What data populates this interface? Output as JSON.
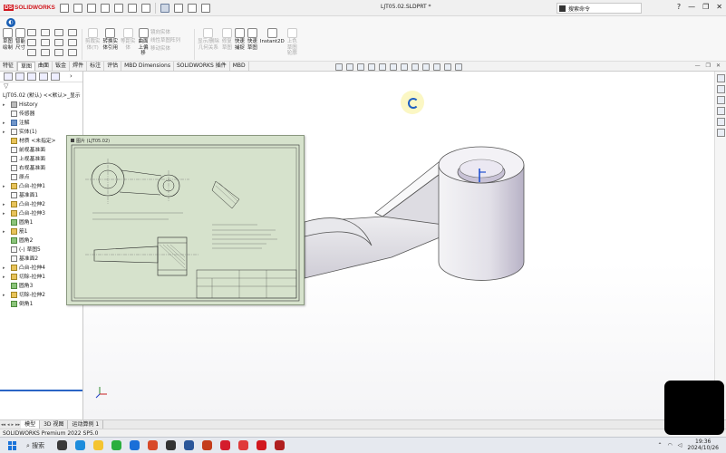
{
  "app": {
    "logo": "SOLIDWORKS",
    "document_title": "LJT05.02.SLDPRT *",
    "search_placeholder": "搜索命令"
  },
  "window_controls": {
    "help": "?",
    "minimize": "—",
    "restore": "❐",
    "close": "✕"
  },
  "ribbon": {
    "command_manager_icon": "expand-icon",
    "sketch_group": [
      {
        "label": "草图\n绘制"
      },
      {
        "label": "智能\n尺寸"
      }
    ],
    "entity_group": [
      {
        "label": "剪裁实\n体(T)",
        "enabled": false
      },
      {
        "label": "转换实\n体引用",
        "enabled": true
      },
      {
        "label": "等距实\n体",
        "enabled": false
      },
      {
        "label": "曲面\n上偏\n移",
        "enabled": true
      }
    ],
    "mirror_list": [
      "镜向实体",
      "线性草图阵列",
      "移动实体"
    ],
    "display_group": [
      {
        "label": "显示/删除\n几何关系",
        "enabled": false
      },
      {
        "label": "修复\n草图",
        "enabled": false
      },
      {
        "label": "快速\n捕捉",
        "enabled": true
      },
      {
        "label": "快速\n草图",
        "enabled": true
      },
      {
        "label": "Instant2D",
        "enabled": true
      },
      {
        "label": "上色\n草图\n轮廓",
        "enabled": false
      }
    ]
  },
  "tabs": [
    "特征",
    "草图",
    "曲面",
    "钣金",
    "焊件",
    "标注",
    "评估",
    "MBD Dimensions",
    "SOLIDWORKS 插件",
    "MBD"
  ],
  "active_tab_index": 1,
  "tree": {
    "root": "LJT05.02 (默认) <<默认>_显示",
    "items": [
      {
        "label": "History",
        "arrow": "▸",
        "icon": "gray"
      },
      {
        "label": "传感器",
        "arrow": "",
        "icon": ""
      },
      {
        "label": "注解",
        "arrow": "▸",
        "icon": "blue"
      },
      {
        "label": "实体(1)",
        "arrow": "▸",
        "icon": ""
      },
      {
        "label": "材质 <未指定>",
        "arrow": "",
        "icon": "yel"
      },
      {
        "label": "前视基准面",
        "arrow": "",
        "icon": ""
      },
      {
        "label": "上视基准面",
        "arrow": "",
        "icon": ""
      },
      {
        "label": "右视基准面",
        "arrow": "",
        "icon": ""
      },
      {
        "label": "原点",
        "arrow": "",
        "icon": ""
      },
      {
        "label": "凸台-拉伸1",
        "arrow": "▸",
        "icon": "yel"
      },
      {
        "label": "基准面1",
        "arrow": "",
        "icon": ""
      },
      {
        "label": "凸台-拉伸2",
        "arrow": "▸",
        "icon": "yel"
      },
      {
        "label": "凸台-拉伸3",
        "arrow": "▸",
        "icon": "yel"
      },
      {
        "label": "圆角1",
        "arrow": "",
        "icon": "green"
      },
      {
        "label": "筋1",
        "arrow": "▸",
        "icon": "yel"
      },
      {
        "label": "圆角2",
        "arrow": "",
        "icon": "green"
      },
      {
        "label": "(-) 草图5",
        "arrow": "",
        "icon": ""
      },
      {
        "label": "基准面2",
        "arrow": "",
        "icon": ""
      },
      {
        "label": "凸台-拉伸4",
        "arrow": "▸",
        "icon": "yel"
      },
      {
        "label": "切除-拉伸1",
        "arrow": "▸",
        "icon": "yel"
      },
      {
        "label": "圆角3",
        "arrow": "",
        "icon": "green"
      },
      {
        "label": "切除-拉伸2",
        "arrow": "▸",
        "icon": "yel"
      },
      {
        "label": "倒角1",
        "arrow": "",
        "icon": "green"
      }
    ]
  },
  "drawing": {
    "caption": "图片 (LJT05.02)"
  },
  "bottom_tabs": [
    "模型",
    "3D 视图",
    "运动算例 1"
  ],
  "active_bottom_tab": 0,
  "status": "SOLIDWORKS Premium 2022 SP5.0",
  "taskbar": {
    "search_label": "搜索",
    "time": "19:36",
    "date": "2024/10/26"
  },
  "colors": {
    "brand": "#d1171e",
    "accent": "#1a5fb4",
    "drawing_bg": "#d6e2cc",
    "part": "#e6e6ea"
  }
}
